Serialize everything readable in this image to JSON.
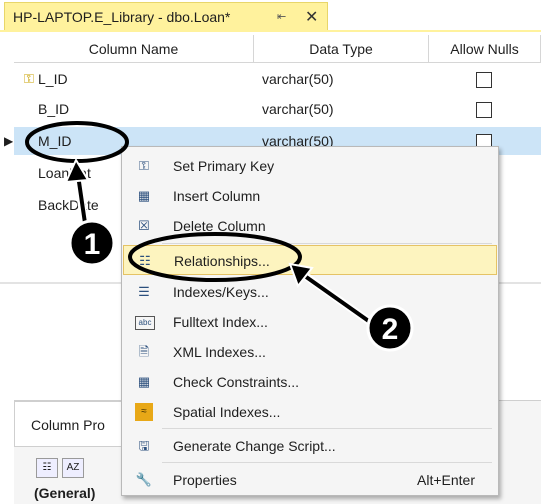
{
  "tab": {
    "title": "HP-LAPTOP.E_Library - dbo.Loan*",
    "pin": "⇤",
    "close": "✕"
  },
  "grid": {
    "headers": [
      "Column Name",
      "Data Type",
      "Allow Nulls"
    ],
    "rows": [
      {
        "name": "L_ID",
        "type": "varchar(50)",
        "key": true
      },
      {
        "name": "B_ID",
        "type": "varchar(50)"
      },
      {
        "name": "M_ID",
        "type": "varchar(50)",
        "selected": true
      },
      {
        "name": "LoanDat",
        "type": ""
      },
      {
        "name": "BackDate",
        "type": ""
      }
    ]
  },
  "properties": {
    "tab_label": "Column Pro",
    "general_label": "(General)"
  },
  "context_menu": {
    "items": [
      {
        "label": "Set Primary Key",
        "icon": "key-icon"
      },
      {
        "label": "Insert Column",
        "icon": "insert-column-icon"
      },
      {
        "label": "Delete Column",
        "icon": "delete-column-icon"
      },
      {
        "label": "Relationships...",
        "icon": "relationships-icon",
        "highlighted": true
      },
      {
        "label": "Indexes/Keys...",
        "icon": "indexes-icon"
      },
      {
        "label": "Fulltext Index...",
        "icon": "fulltext-icon"
      },
      {
        "label": "XML Indexes...",
        "icon": "xml-icon"
      },
      {
        "label": "Check Constraints...",
        "icon": "check-icon"
      },
      {
        "label": "Spatial Indexes...",
        "icon": "spatial-icon"
      },
      {
        "label": "Generate Change Script...",
        "icon": "script-icon"
      },
      {
        "label": "Properties",
        "icon": "wrench-icon",
        "shortcut": "Alt+Enter"
      }
    ]
  },
  "annotations": {
    "step1": "1",
    "step2": "2"
  }
}
